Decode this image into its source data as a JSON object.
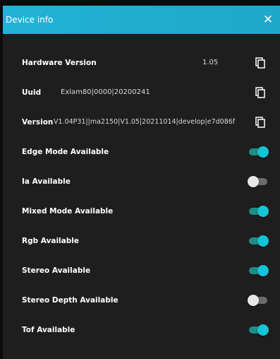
{
  "dialog": {
    "title": "Device info",
    "close_icon": "close-icon",
    "colors": {
      "header": "#21b3d6",
      "background": "#1e1e1e",
      "toggle_on": "#13c4d6",
      "toggle_off": "#e6e6e6"
    }
  },
  "info": [
    {
      "label": "Hardware Version",
      "value": "1.05",
      "icon": "copy-icon"
    },
    {
      "label": "Uuid",
      "value": "Exlam80|0000|20200241",
      "icon": "copy-icon"
    },
    {
      "label": "Version",
      "value": "V1.04P31||ma2150|V1.05|20211014|develop|e7d086f",
      "icon": "copy-icon"
    }
  ],
  "toggles": [
    {
      "label": "Edge Mode Available",
      "on": true
    },
    {
      "label": "Ia Available",
      "on": false
    },
    {
      "label": "Mixed Mode Available",
      "on": true
    },
    {
      "label": "Rgb Available",
      "on": true
    },
    {
      "label": "Stereo Available",
      "on": true
    },
    {
      "label": "Stereo Depth Available",
      "on": false
    },
    {
      "label": "Tof Available",
      "on": true
    }
  ]
}
